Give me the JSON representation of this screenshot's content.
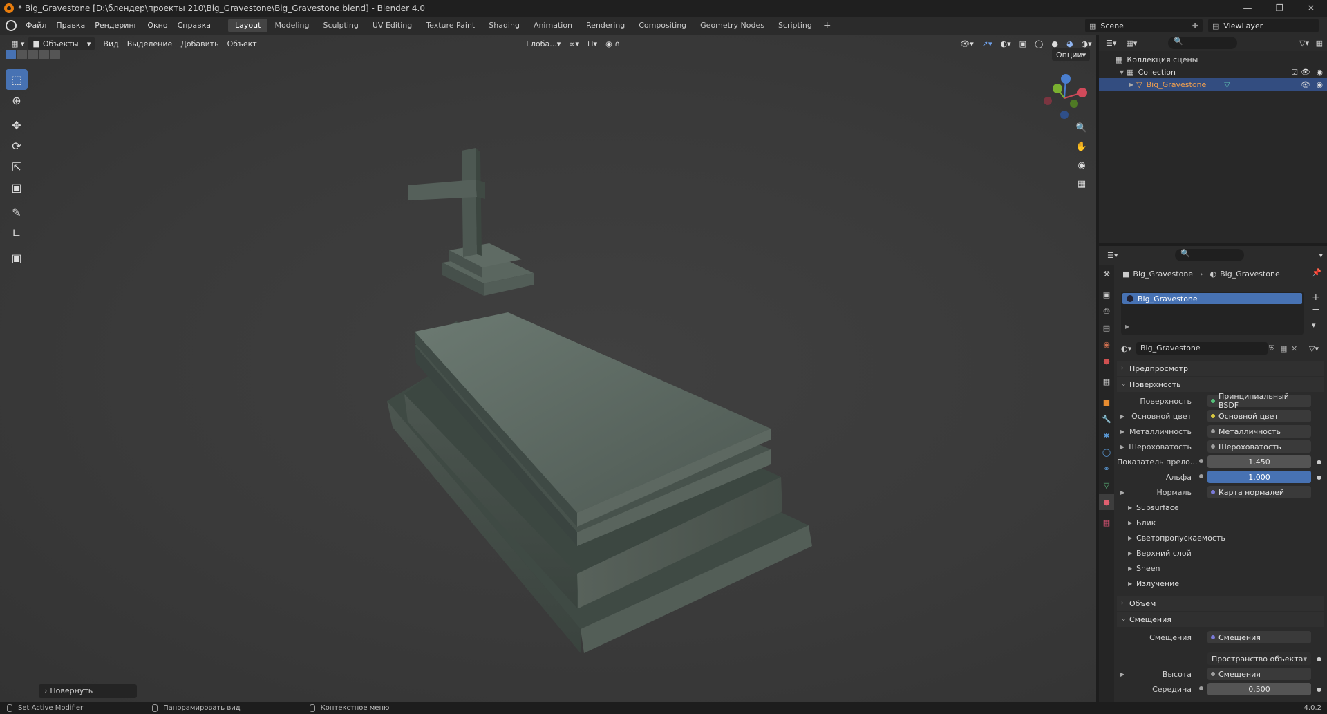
{
  "window": {
    "title": "* Big_Gravestone [D:\\блендер\\проекты 210\\Big_Gravestone\\Big_Gravestone.blend] - Blender 4.0"
  },
  "menu": [
    "Файл",
    "Правка",
    "Рендеринг",
    "Окно",
    "Справка"
  ],
  "workspaces": [
    "Layout",
    "Modeling",
    "Sculpting",
    "UV Editing",
    "Texture Paint",
    "Shading",
    "Animation",
    "Rendering",
    "Compositing",
    "Geometry Nodes",
    "Scripting"
  ],
  "active_workspace": "Layout",
  "scene": {
    "name": "Scene",
    "view_layer": "ViewLayer"
  },
  "viewport": {
    "mode": "Объекты",
    "menus": [
      "Вид",
      "Выделение",
      "Добавить",
      "Объект"
    ],
    "transform_orientation": "Глоба...",
    "options_label": "Опции",
    "last_operator": "Повернуть"
  },
  "outliner": {
    "root": "Коллекция сцены",
    "collection": "Collection",
    "object": "Big_Gravestone"
  },
  "properties": {
    "breadcrumb": [
      "Big_Gravestone",
      "Big_Gravestone"
    ],
    "material_slot": "Big_Gravestone",
    "material_name": "Big_Gravestone",
    "sections": {
      "preview": "Предпросмотр",
      "surface": "Поверхность",
      "volume": "Объём",
      "displacement": "Смещения"
    },
    "surface": {
      "shader_label": "Поверхность",
      "shader_value": "Принципиальный BSDF",
      "base_color_label": "Основной цвет",
      "base_color_value": "Основной цвет",
      "metallic_label": "Металличность",
      "metallic_value": "Металличность",
      "roughness_label": "Шероховатость",
      "roughness_value": "Шероховатость",
      "ior_label": "Показатель прело...",
      "ior_value": "1.450",
      "alpha_label": "Альфа",
      "alpha_value": "1.000",
      "normal_label": "Нормаль",
      "normal_value": "Карта нормалей"
    },
    "subsections": [
      "Subsurface",
      "Блик",
      "Светопропускаемость",
      "Верхний слой",
      "Sheen",
      "Излучение"
    ],
    "displacement": {
      "disp_label": "Смещения",
      "disp_value": "Смещения",
      "space_value": "Пространство объекта",
      "height_label": "Высота",
      "height_value": "Смещения",
      "midlevel_label": "Середина",
      "midlevel_value": "0.500"
    }
  },
  "statusbar": {
    "items": [
      "Set Active Modifier",
      "Панорамировать вид",
      "Контекстное меню"
    ],
    "version": "4.0.2"
  },
  "colors": {
    "accent": "#4772b3",
    "object_orange": "#e87d0d"
  }
}
